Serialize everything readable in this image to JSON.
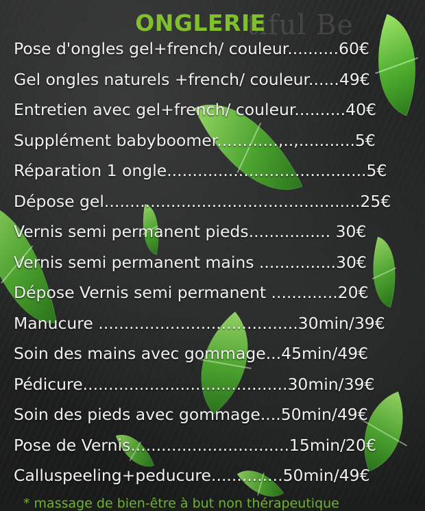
{
  "title": "ONGLERIE",
  "watermark": "tiful Be",
  "items": [
    "Pose d'ongles  gel+french/ couleur..........60€",
    "Gel ongles naturels +french/ couleur......49€",
    "Entretien avec gel+french/ couleur..........40€",
    "Supplément babyboomer............,..,...........5€",
    "Réparation 1 ongle.......................................5€",
    "Dépose gel..................................................25€",
    "Vernis semi permanent pieds................ 30€",
    "Vernis semi permanent mains ...............30€",
    "Dépose Vernis semi permanent .............20€",
    "Manucure .......................................30min/39€",
    "Soin des mains avec gommage...45min/49€",
    "Pédicure........................................30min/39€",
    "Soin des pieds avec gommage....50min/49€",
    "Pose de Vernis...............................15min/20€",
    "Calluspeeling+peducure..............50min/49€"
  ],
  "footer": "* massage de bien-être à but non thérapeutique",
  "colors": {
    "title": "#7fc02c",
    "text": "#f1f1f1",
    "leaf": "#4fae2f"
  }
}
